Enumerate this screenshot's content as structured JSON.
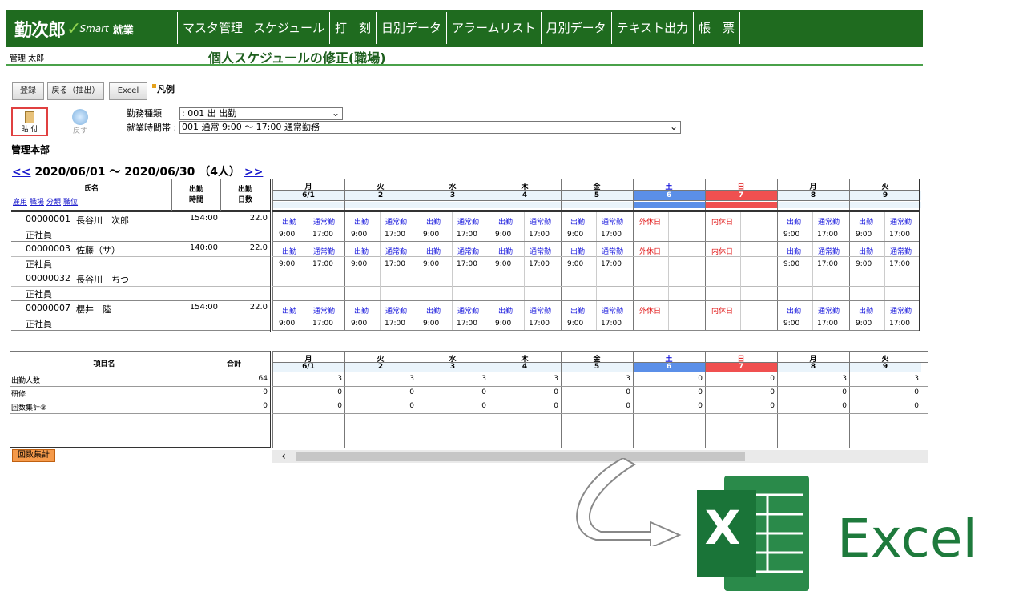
{
  "app": {
    "logo_kanji": "勤次郎",
    "logo_smart": "Smart",
    "logo_suffix": "就業"
  },
  "menu": [
    "マスタ管理",
    "スケジュール",
    "打　刻",
    "日別データ",
    "アラームリスト",
    "月別データ",
    "テキスト出力",
    "帳　票"
  ],
  "user_name": "管理 太郎",
  "page_title": "個人スケジュールの修正(職場)",
  "toolbar": {
    "register": "登録",
    "back": "戻る（抽出）",
    "excel": "Excel",
    "legend": "凡例",
    "paste": "貼 付",
    "undo": "戻す"
  },
  "form": {
    "work_type_label": "勤務種類",
    "work_type_value": ": 001  出  出勤",
    "work_hours_label": "就業時間帯 :",
    "work_hours_value": "001       通常      9:00 ～ 17:00  通常勤務"
  },
  "department": "管理本部",
  "period": {
    "prev": "<<",
    "range": "2020/06/01 ～ 2020/06/30 （4人）",
    "next": ">>"
  },
  "schedule": {
    "name_header": "氏名",
    "sub_links": [
      "雇用",
      "職場",
      "分類",
      "職位"
    ],
    "col_hours_header": "出勤\n時間",
    "col_days_header": "出勤\n日数",
    "days": [
      {
        "dow": "月",
        "date": "6/1",
        "type": "weekday"
      },
      {
        "dow": "火",
        "date": "2",
        "type": "weekday"
      },
      {
        "dow": "水",
        "date": "3",
        "type": "weekday"
      },
      {
        "dow": "木",
        "date": "4",
        "type": "weekday"
      },
      {
        "dow": "金",
        "date": "5",
        "type": "weekday"
      },
      {
        "dow": "土",
        "date": "6",
        "type": "sat"
      },
      {
        "dow": "日",
        "date": "7",
        "type": "sun"
      },
      {
        "dow": "月",
        "date": "8",
        "type": "weekday"
      },
      {
        "dow": "火",
        "date": "9",
        "type": "weekday"
      }
    ],
    "employees": [
      {
        "id": "00000001",
        "name": "長谷川　次郎",
        "role": "正社員",
        "hours": "154:00",
        "days": "22.0",
        "sched": "normal"
      },
      {
        "id": "00000003",
        "name": "佐藤（サ）",
        "role": "正社員",
        "hours": "140:00",
        "days": "22.0",
        "sched": "normal"
      },
      {
        "id": "00000032",
        "name": "長谷川　ちつ",
        "role": "正社員",
        "hours": "",
        "days": "",
        "sched": "empty"
      },
      {
        "id": "00000007",
        "name": "櫻井　陸",
        "role": "正社員",
        "hours": "154:00",
        "days": "22.0",
        "sched": "normal"
      }
    ],
    "work": {
      "code": "出勤",
      "pattern": "通常勤",
      "start": "9:00",
      "end": "17:00",
      "sat_label": "外休日",
      "sun_label": "内休日"
    }
  },
  "summary": {
    "item_header": "項目名",
    "total_header": "合計",
    "rows": [
      {
        "name": "出勤人数",
        "total": "64",
        "values": [
          "3",
          "3",
          "3",
          "3",
          "3",
          "0",
          "0",
          "3",
          "3"
        ]
      },
      {
        "name": "研修",
        "total": "0",
        "values": [
          "0",
          "0",
          "0",
          "0",
          "0",
          "0",
          "0",
          "0",
          "0"
        ]
      },
      {
        "name": "回数集計③",
        "total": "0",
        "values": [
          "0",
          "0",
          "0",
          "0",
          "0",
          "0",
          "0",
          "0",
          "0"
        ]
      }
    ],
    "tab": "回数集計"
  },
  "excel_logo": {
    "letter": "X",
    "word": "Excel"
  },
  "colors": {
    "header_green": "#1f6b1f",
    "sat_blue": "#5b8fe8",
    "sun_red": "#f05050",
    "excel_green": "#1e7a3c"
  }
}
